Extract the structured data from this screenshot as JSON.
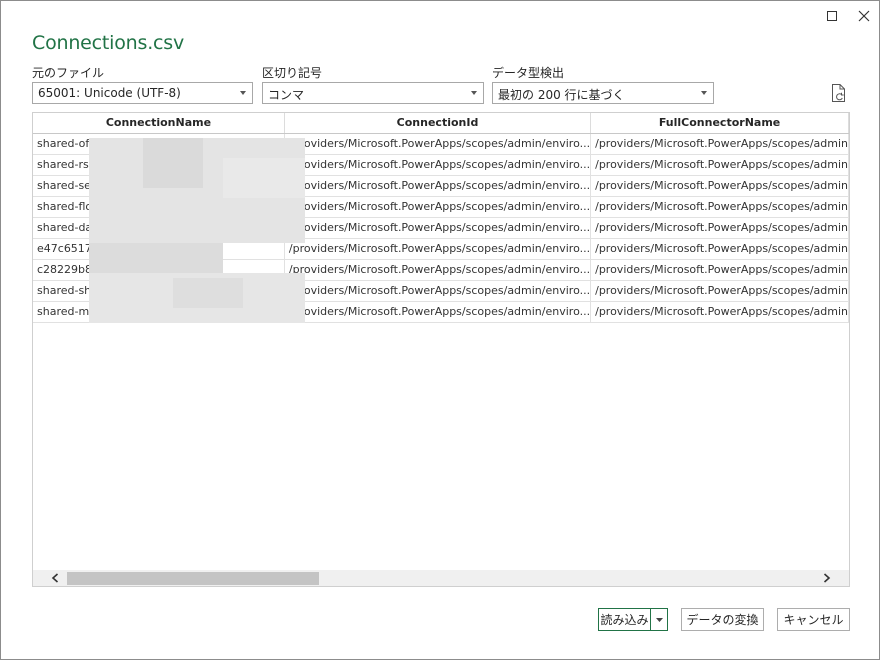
{
  "window": {
    "title": "Connections.csv",
    "maximize_icon": "maximize-icon",
    "close_icon": "close-icon"
  },
  "options": {
    "file_origin": {
      "label": "元のファイル",
      "value": "65001: Unicode (UTF-8)"
    },
    "delimiter": {
      "label": "区切り記号",
      "value": "コンマ"
    },
    "data_type_detection": {
      "label": "データ型検出",
      "value": "最初の 200 行に基づく"
    },
    "refresh_icon": "refresh-document-icon"
  },
  "table": {
    "columns": [
      "ConnectionName",
      "ConnectionId",
      "FullConnectorName"
    ],
    "rows": [
      [
        "shared-off",
        "/providers/Microsoft.PowerApps/scopes/admin/enviro...",
        "/providers/Microsoft.PowerApps/scopes/admin"
      ],
      [
        "shared-rss",
        "/providers/Microsoft.PowerApps/scopes/admin/enviro...",
        "/providers/Microsoft.PowerApps/scopes/admin"
      ],
      [
        "shared-ser",
        "/providers/Microsoft.PowerApps/scopes/admin/enviro...",
        "/providers/Microsoft.PowerApps/scopes/admin"
      ],
      [
        "shared-flov",
        "/providers/Microsoft.PowerApps/scopes/admin/enviro...",
        "/providers/Microsoft.PowerApps/scopes/admin"
      ],
      [
        "shared-dat",
        "/providers/Microsoft.PowerApps/scopes/admin/enviro...",
        "/providers/Microsoft.PowerApps/scopes/admin"
      ],
      [
        "e47c65178",
        "/providers/Microsoft.PowerApps/scopes/admin/enviro...",
        "/providers/Microsoft.PowerApps/scopes/admin"
      ],
      [
        "c28229b80",
        "/providers/Microsoft.PowerApps/scopes/admin/enviro...",
        "/providers/Microsoft.PowerApps/scopes/admin"
      ],
      [
        "shared-sha",
        "/providers/Microsoft.PowerApps/scopes/admin/enviro...",
        "/providers/Microsoft.PowerApps/scopes/admin"
      ],
      [
        "shared-ms",
        "/providers/Microsoft.PowerApps/scopes/admin/enviro...",
        "/providers/Microsoft.PowerApps/scopes/admin"
      ]
    ]
  },
  "buttons": {
    "load": "読み込み",
    "transform": "データの変換",
    "cancel": "キャンセル"
  },
  "colors": {
    "accent": "#217346",
    "border": "#adadad"
  }
}
